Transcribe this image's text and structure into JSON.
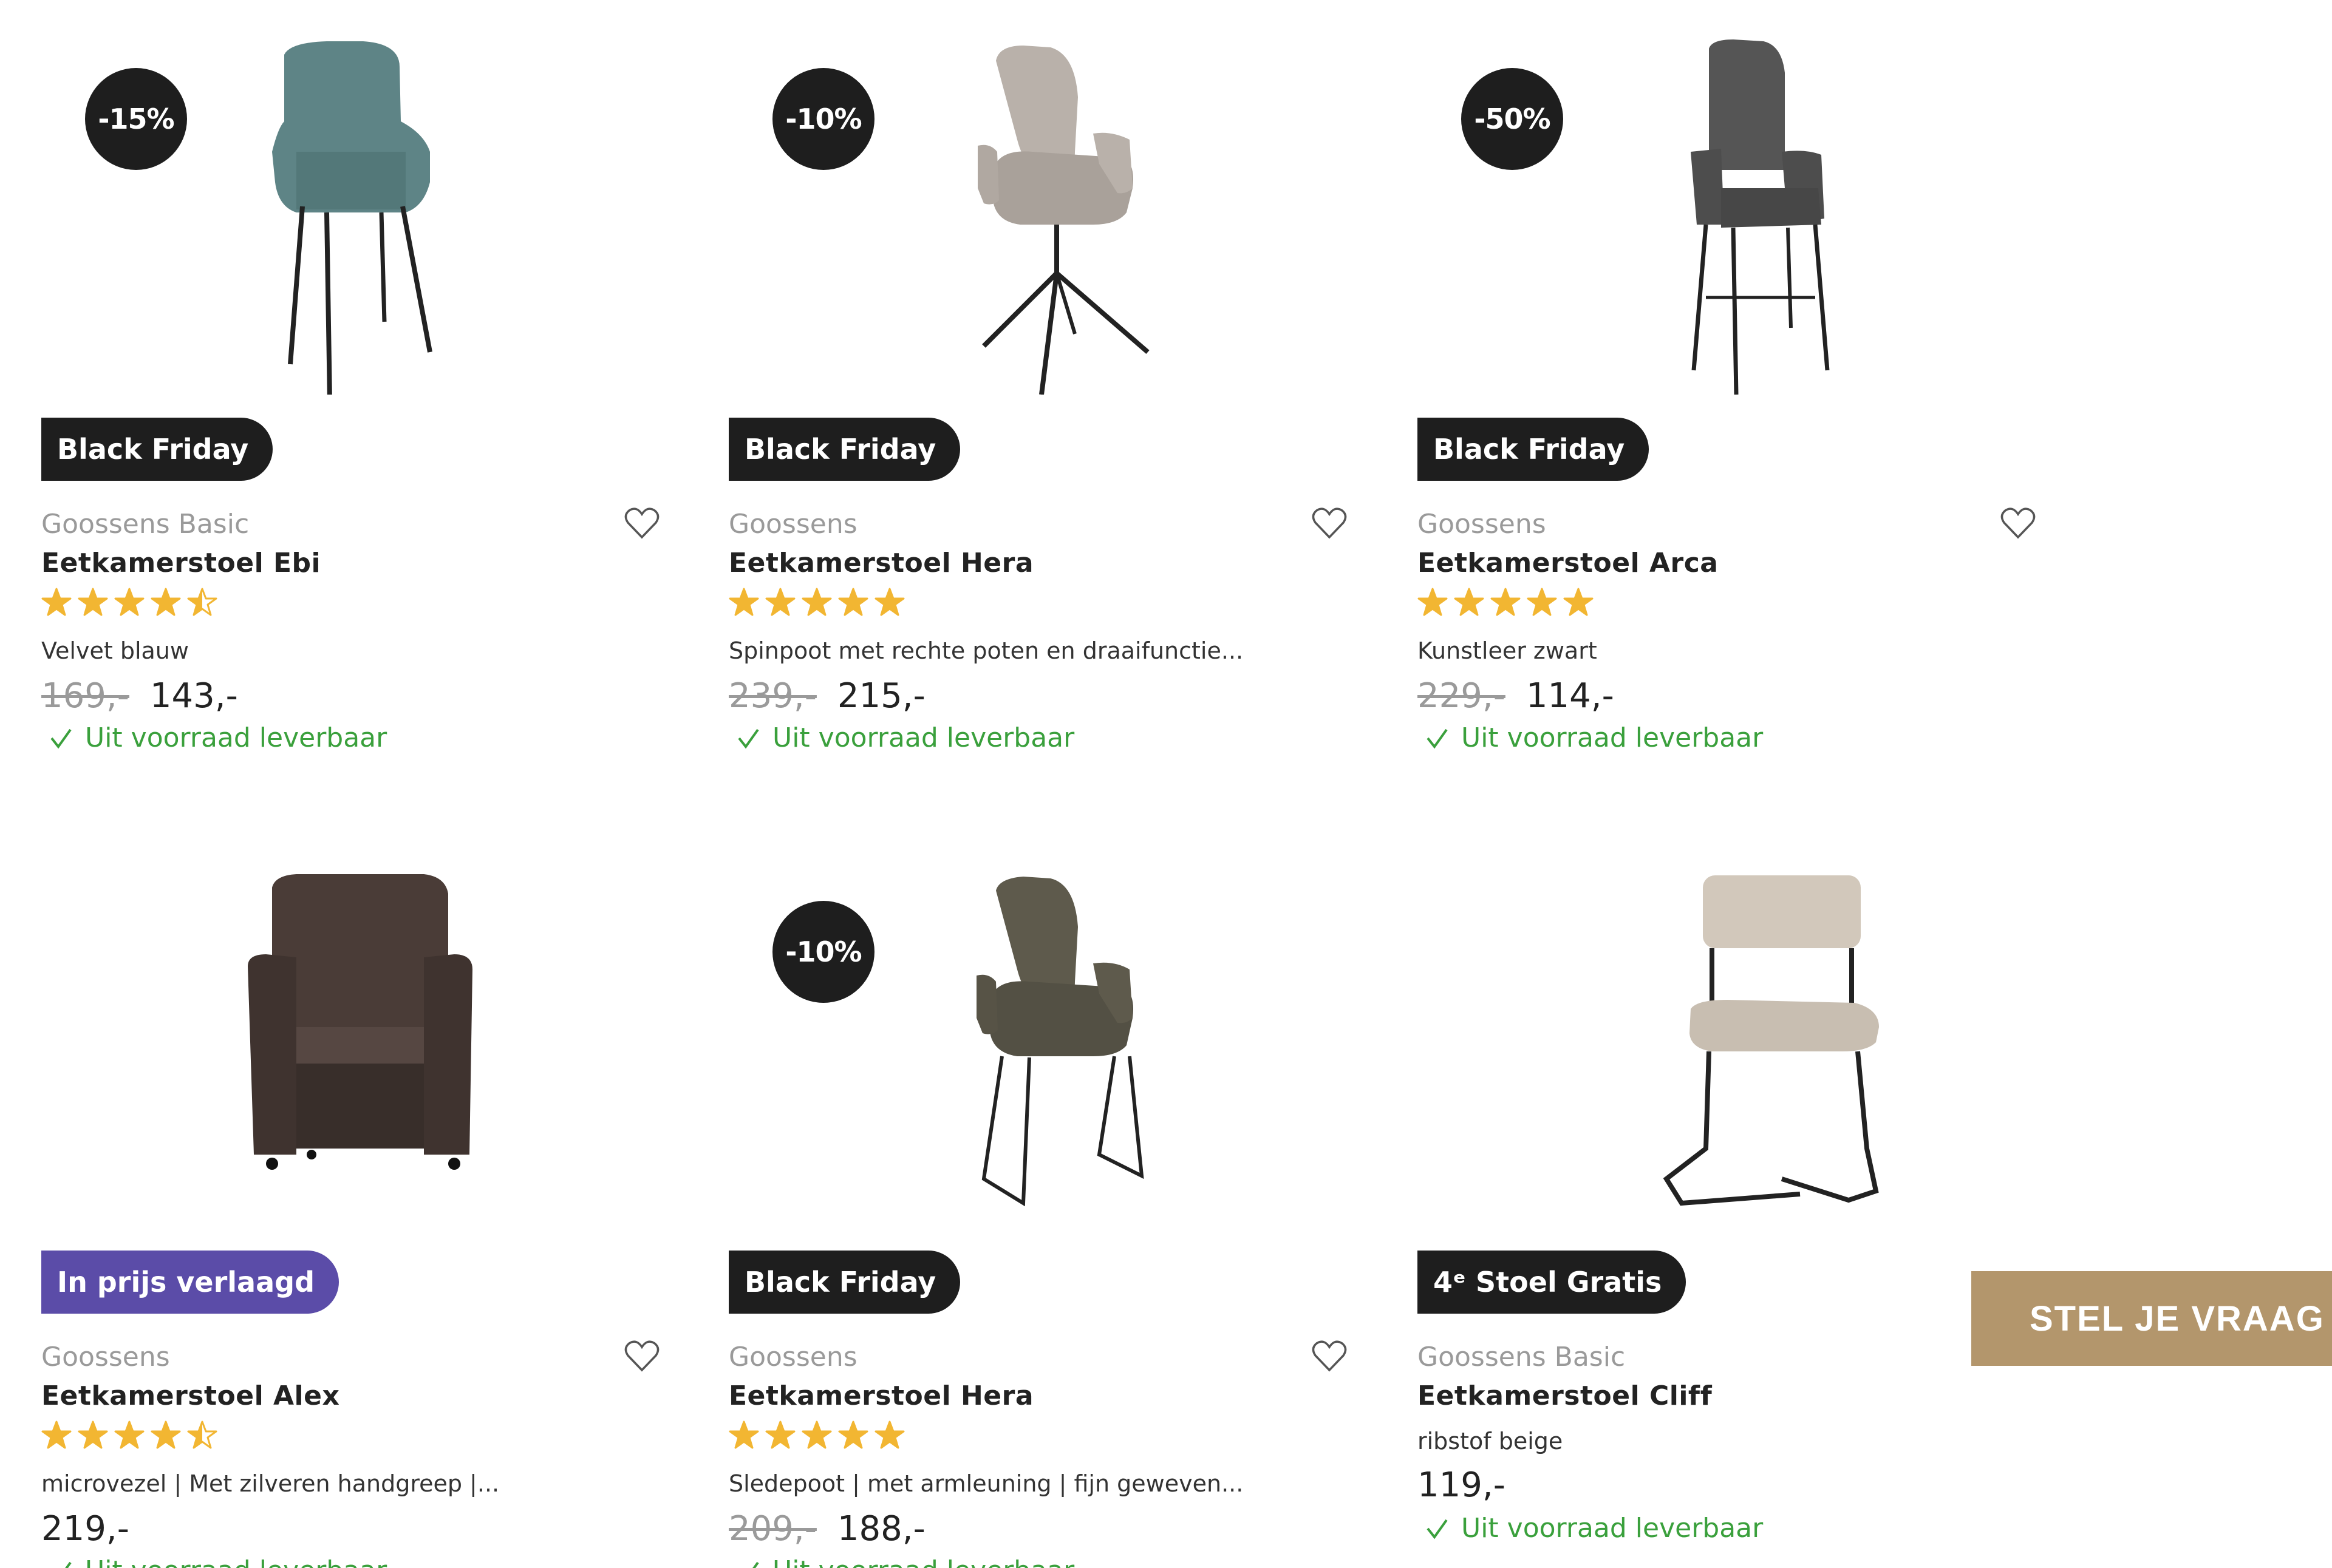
{
  "colors": {
    "badge_dark": "#1e1e1e",
    "badge_purple": "#5b4ca8",
    "star": "#f2b632",
    "stock_green": "#3aa03c",
    "ask_button": "#b3966c"
  },
  "products": [
    {
      "discount": "-15%",
      "promo": "Black Friday",
      "brand": "Goossens Basic",
      "name": "Eetkamerstoel Ebi",
      "rating": 4.5,
      "description": "Velvet blauw",
      "old_price": "169,-",
      "price": "143,-",
      "stock": "Uit voorraad leverbaar",
      "color": "#5e8486"
    },
    {
      "discount": "-10%",
      "promo": "Black Friday",
      "brand": "Goossens",
      "name": "Eetkamerstoel Hera",
      "rating": 5,
      "description": "Spinpoot met rechte poten en draaifunctie...",
      "old_price": "239,-",
      "price": "215,-",
      "stock": "Uit voorraad leverbaar",
      "color": "#b9b1aa"
    },
    {
      "discount": "-50%",
      "promo": "Black Friday",
      "brand": "Goossens",
      "name": "Eetkamerstoel Arca",
      "rating": 5,
      "description": "Kunstleer zwart",
      "old_price": "229,-",
      "price": "114,-",
      "stock": "Uit voorraad leverbaar",
      "color": "#555555"
    },
    {
      "discount": "",
      "promo": "In prijs verlaagd",
      "brand": "Goossens",
      "name": "Eetkamerstoel Alex",
      "rating": 4.5,
      "description": "microvezel | Met zilveren handgreep |...",
      "old_price": "",
      "price": "219,-",
      "stock": "Uit voorraad leverbaar",
      "color": "#4a3c37"
    },
    {
      "discount": "-10%",
      "promo": "Black Friday",
      "brand": "Goossens",
      "name": "Eetkamerstoel Hera",
      "rating": 5,
      "description": "Sledepoot | met armleuning | fijn geweven...",
      "old_price": "209,-",
      "price": "188,-",
      "stock": "Uit voorraad leverbaar",
      "color": "#5e5a4c"
    },
    {
      "discount": "",
      "promo": "4ᵉ Stoel Gratis",
      "brand": "Goossens Basic",
      "name": "Eetkamerstoel Cliff",
      "rating": null,
      "description": "ribstof beige",
      "old_price": "",
      "price": "119,-",
      "stock": "Uit voorraad leverbaar",
      "color": "#d2c8bb"
    }
  ],
  "ask_button": {
    "label": "STEL JE VRAAG"
  }
}
